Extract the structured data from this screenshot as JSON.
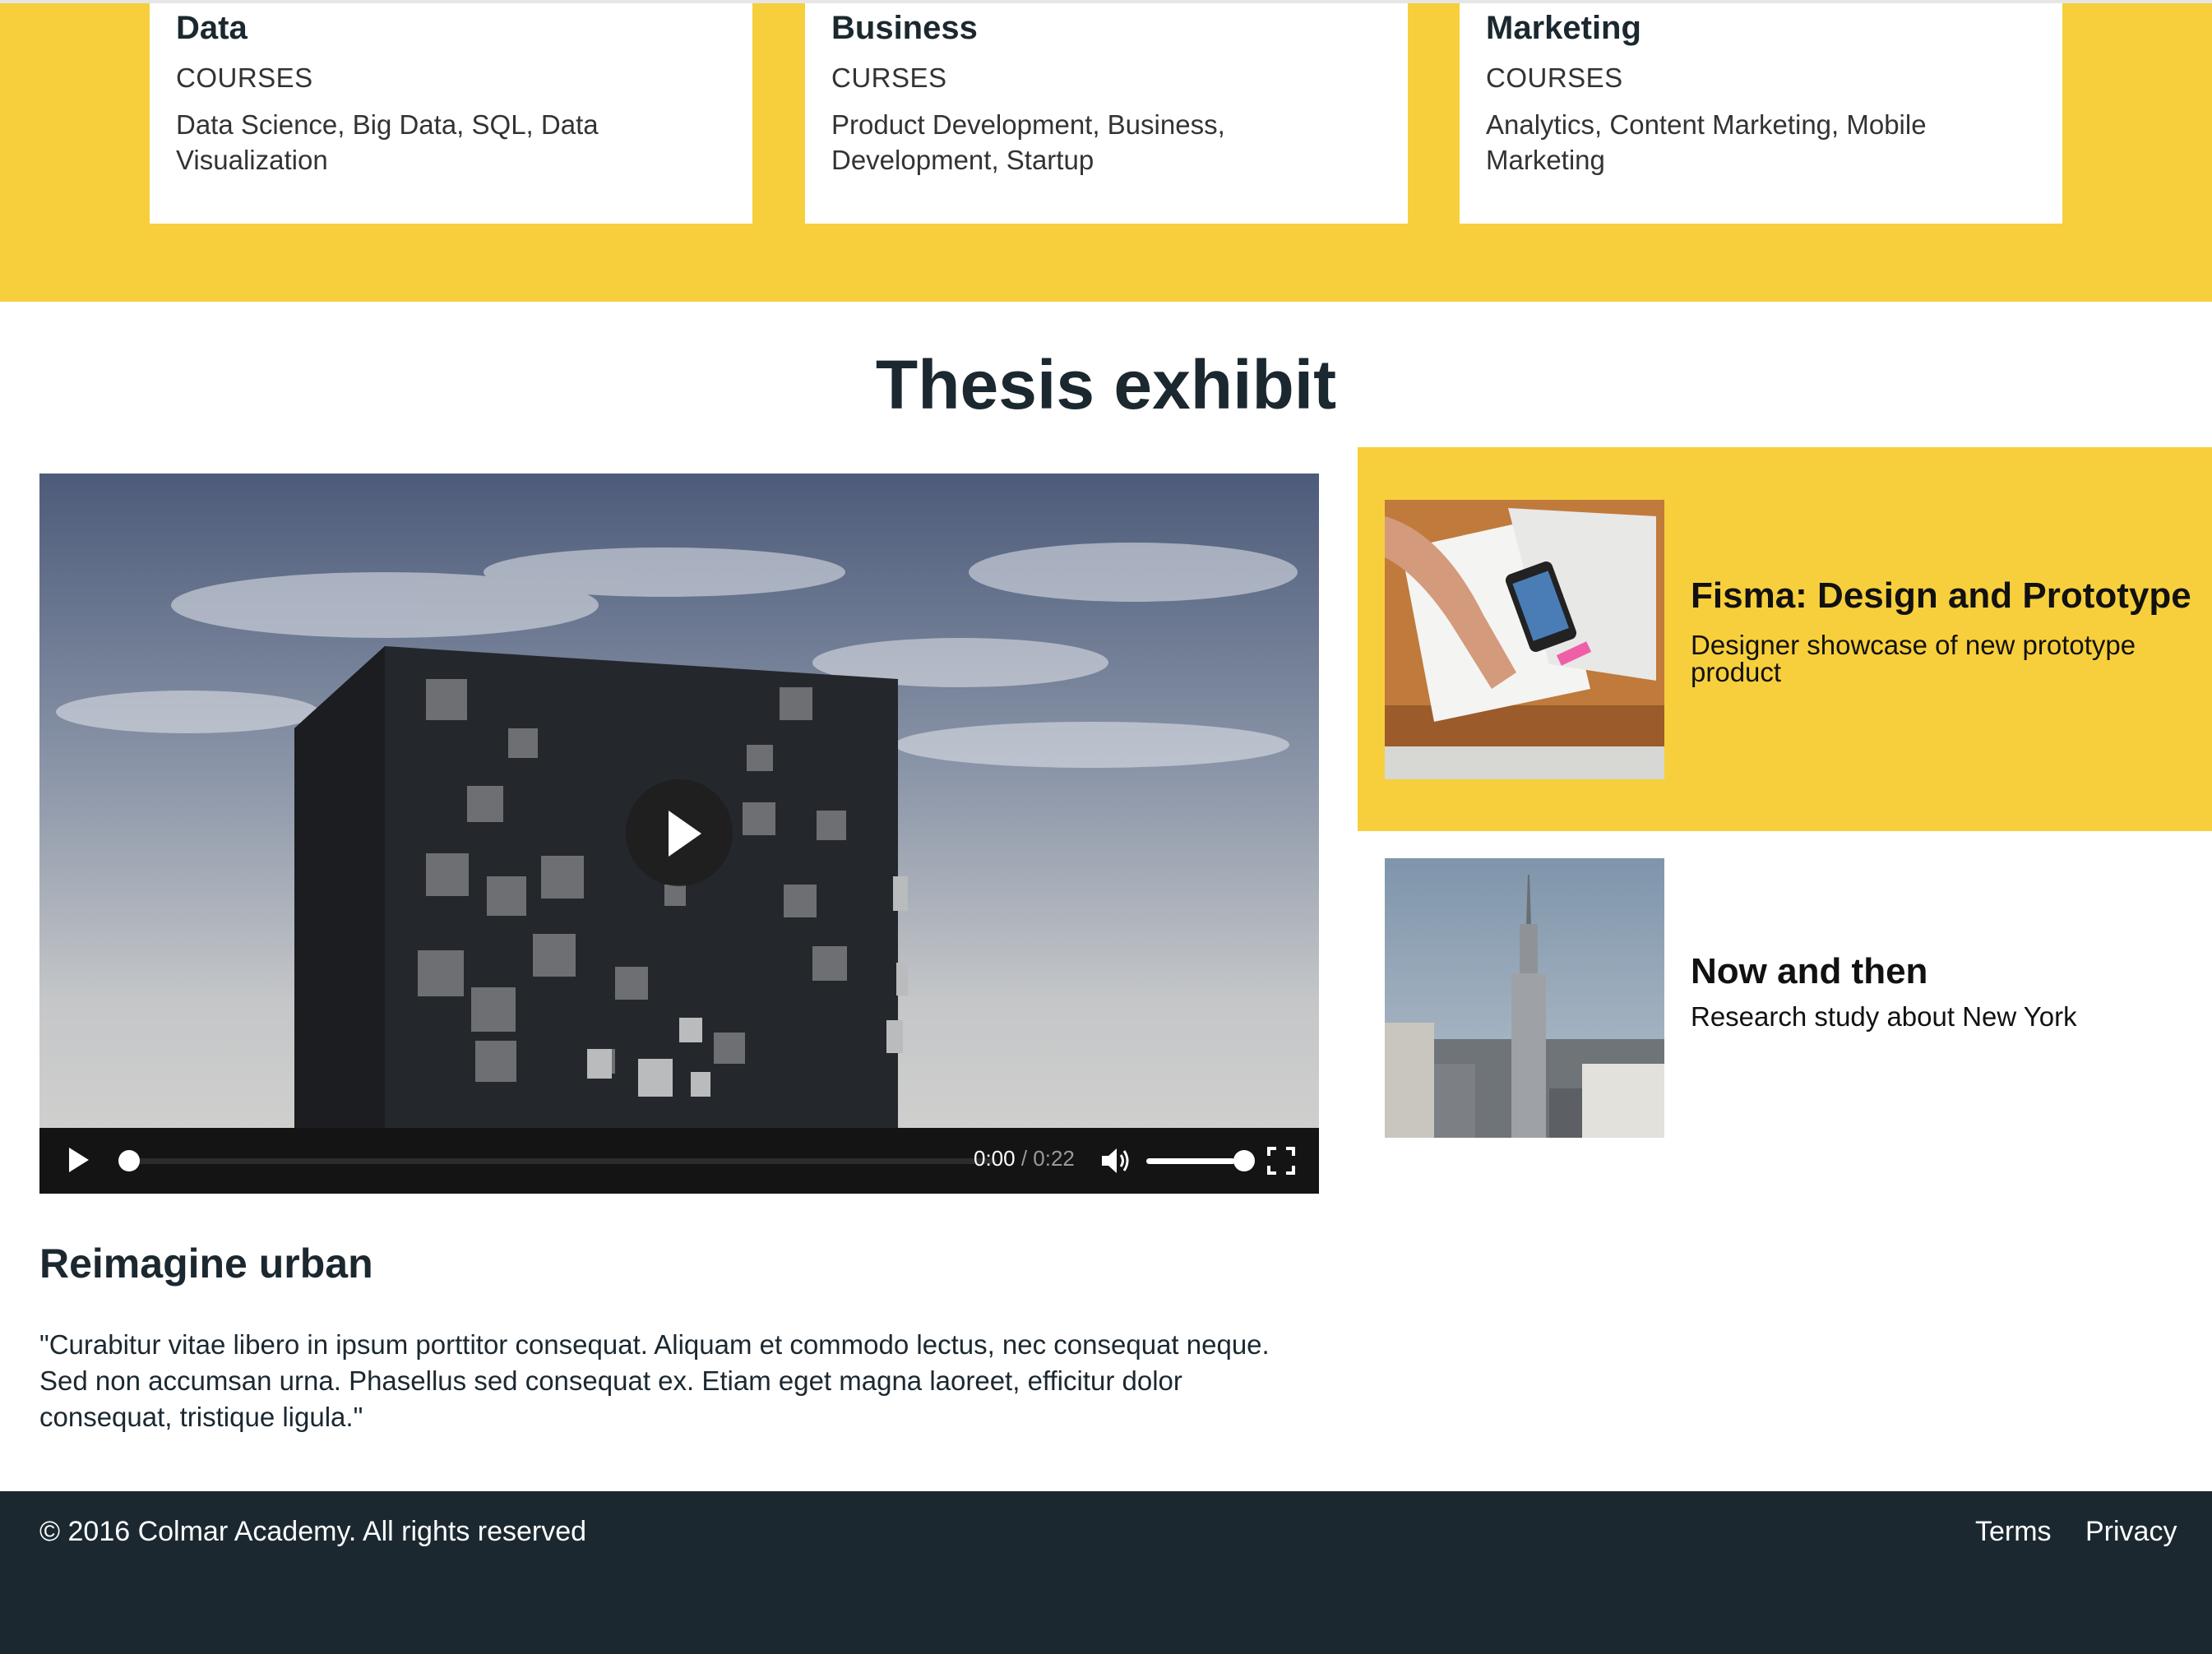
{
  "courses": [
    {
      "title": "Data",
      "subtitle": "COURSES",
      "topics": "Data Science, Big Data, SQL, Data Visualization"
    },
    {
      "title": "Business",
      "subtitle": "CURSES",
      "topics": "Product Development, Business, Development, Startup"
    },
    {
      "title": "Marketing",
      "subtitle": "COURSES",
      "topics": "Analytics, Content Marketing, Mobile Marketing"
    }
  ],
  "thesis": {
    "title": "Thesis exhibit",
    "video": {
      "current_time": "0:00",
      "separator": " / ",
      "duration": "0:22",
      "progress": 0.0,
      "volume": 1.0
    },
    "article": {
      "title": "Reimagine urban",
      "body": "\"Curabitur vitae libero in ipsum porttitor consequat. Aliquam et commodo lectus, nec consequat neque. Sed non accumsan urna. Phasellus sed consequat ex. Etiam eget magna laoreet, efficitur dolor consequat, tristique ligula.\""
    },
    "side_items": [
      {
        "title": "Fisma: Design and Prototype",
        "description": "Designer showcase of new prototype product"
      },
      {
        "title": "Now and then",
        "description": "Research study about New York"
      }
    ]
  },
  "footer": {
    "copyright": "© 2016 Colmar Academy. All rights reserved",
    "links": [
      "Terms",
      "Privacy"
    ]
  },
  "colors": {
    "accent": "#f7cf3c",
    "dark": "#1b2830"
  }
}
